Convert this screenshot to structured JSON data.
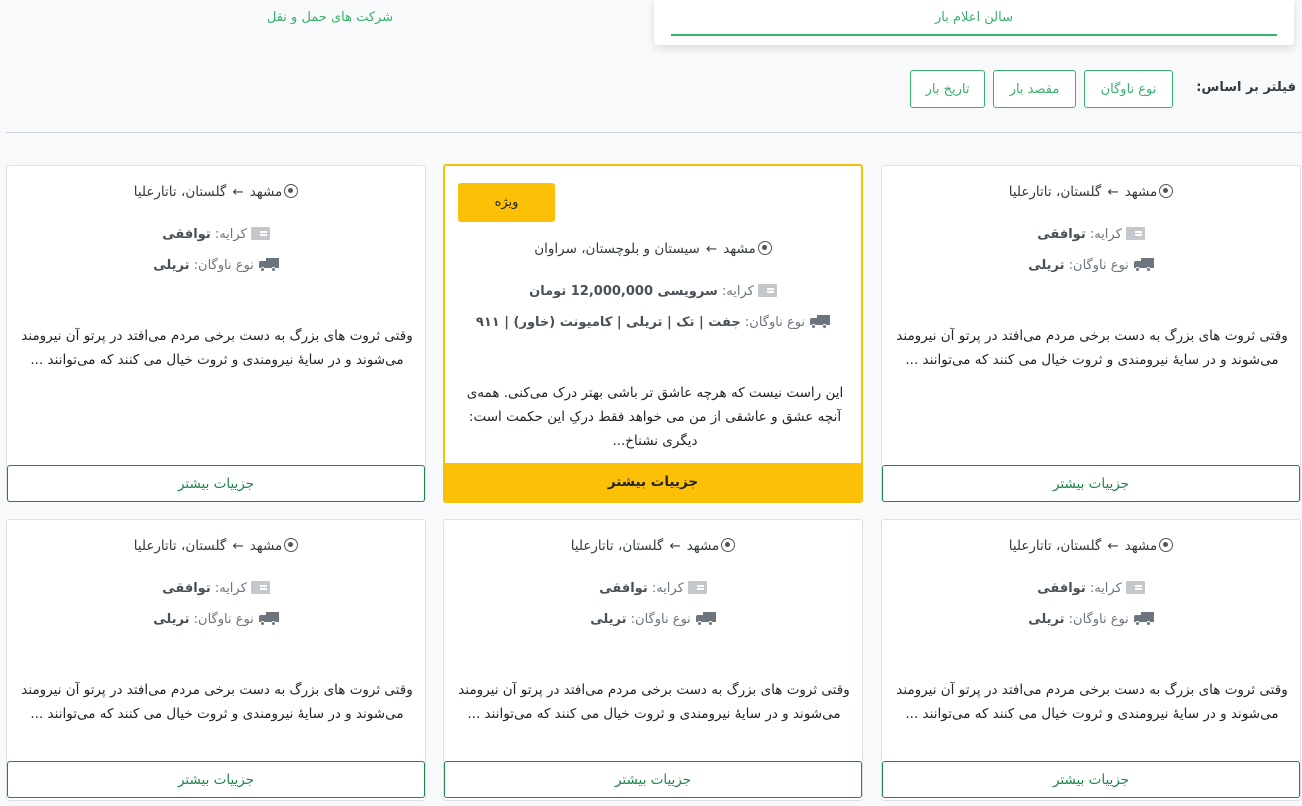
{
  "tabs": {
    "active": "سالن اعلام بار",
    "inactive": "شرکت های حمل و نقل"
  },
  "filter": {
    "label": "فیلتر بر اساس:",
    "buttons": [
      "نوع ناوگان",
      "مقصد بار",
      "تاریخ بار"
    ]
  },
  "labels": {
    "fare": "کرایه:",
    "fleet": "نوع ناوگان:",
    "details": "جزییات بیشتر",
    "arrow": "←"
  },
  "featured": {
    "badge": "ویژه",
    "origin": "مشهد",
    "destination": "سیستان و بلوچستان، سراوان",
    "fare": "سرویسی 12,000,000 تومان",
    "fleet": "جفت | تک | تریلی | کامیونت (خاور) | ۹۱۱",
    "description": "این راست نیست که هرچه عاشق تر باشی بهتر درک می‌کنی. همه‌ی آنچه عشق و عاشقی از من می خواهد فقط درکِ این حکمت است: دیگری نشناخ..."
  },
  "cards": [
    {
      "origin": "مشهد",
      "destination": "گلستان، تاتارعلیا",
      "fare": "توافقی",
      "fleet": "تریلی",
      "description": "وقتی ثروت های بزرگ به دست برخی مردم می‌افتد در پرتو آن نیرومند می‌شوند و در سایهٔ نیرومندی و ثروت خیال می کنند که می‌توانند ..."
    },
    {
      "origin": "مشهد",
      "destination": "گلستان، تاتارعلیا",
      "fare": "توافقی",
      "fleet": "تریلی",
      "description": "وقتی ثروت های بزرگ به دست برخی مردم می‌افتد در پرتو آن نیرومند می‌شوند و در سایهٔ نیرومندی و ثروت خیال می کنند که می‌توانند ..."
    },
    {
      "origin": "مشهد",
      "destination": "گلستان، تاتارعلیا",
      "fare": "توافقی",
      "fleet": "تریلی",
      "description": "وقتی ثروت های بزرگ به دست برخی مردم می‌افتد در پرتو آن نیرومند می‌شوند و در سایهٔ نیرومندی و ثروت خیال می کنند که می‌توانند ..."
    },
    {
      "origin": "مشهد",
      "destination": "گلستان، تاتارعلیا",
      "fare": "توافقی",
      "fleet": "تریلی",
      "description": "وقتی ثروت های بزرگ به دست برخی مردم می‌افتد در پرتو آن نیرومند می‌شوند و در سایهٔ نیرومندی و ثروت خیال می کنند که می‌توانند ..."
    },
    {
      "origin": "مشهد",
      "destination": "گلستان، تاتارعلیا",
      "fare": "توافقی",
      "fleet": "تریلی",
      "description": "وقتی ثروت های بزرگ به دست برخی مردم می‌افتد در پرتو آن نیرومند می‌شوند و در سایهٔ نیرومندی و ثروت خیال می کنند که می‌توانند ..."
    }
  ],
  "colors": {
    "accent": "#38b26a",
    "featured": "#fcc106"
  }
}
